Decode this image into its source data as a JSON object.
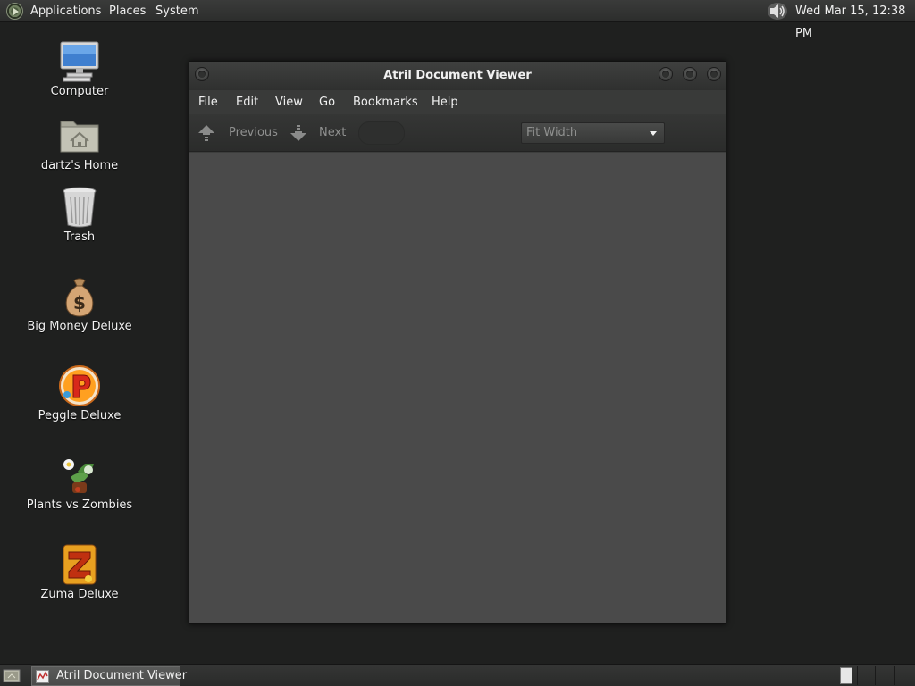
{
  "top_panel": {
    "menus": [
      "Applications",
      "Places",
      "System"
    ],
    "clock": "Wed Mar 15, 12:38 PM"
  },
  "desktop": {
    "icons": [
      {
        "label": "Computer",
        "icon": "computer-icon"
      },
      {
        "label": "dartz's Home",
        "icon": "home-folder-icon"
      },
      {
        "label": "Trash",
        "icon": "trash-icon"
      },
      {
        "label": "Big Money Deluxe",
        "icon": "money-bag-icon"
      },
      {
        "label": "Peggle Deluxe",
        "icon": "peggle-icon"
      },
      {
        "label": "Plants vs Zombies",
        "icon": "plants-vs-zombies-icon"
      },
      {
        "label": "Zuma Deluxe",
        "icon": "zuma-icon"
      }
    ]
  },
  "window": {
    "title": "Atril Document Viewer",
    "menubar": [
      "File",
      "Edit",
      "View",
      "Go",
      "Bookmarks",
      "Help"
    ],
    "toolbar": {
      "previous_label": "Previous",
      "next_label": "Next",
      "zoom_value": "Fit Width"
    }
  },
  "taskbar": {
    "task_label": "Atril Document Viewer"
  }
}
